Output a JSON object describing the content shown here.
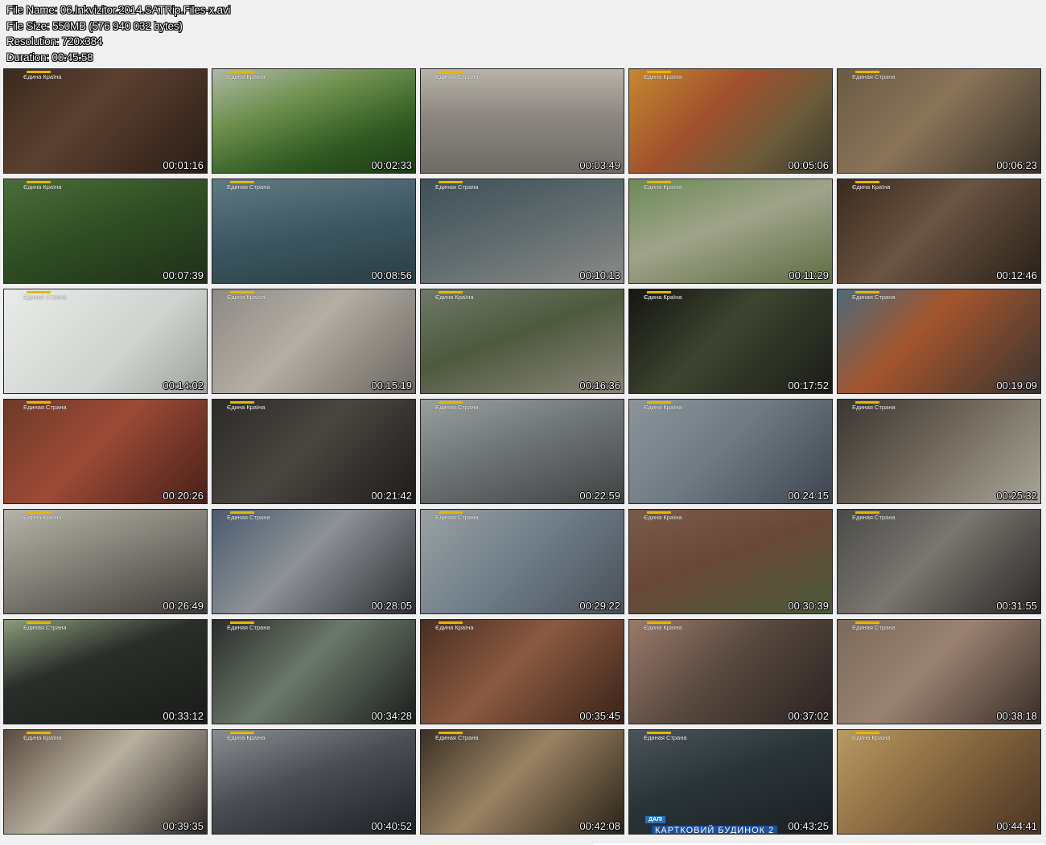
{
  "info": {
    "file_name": "File Name: 06.Inkvizitor.2014.SATRip.Files-x.avi",
    "file_size": "File Size: 550MB (576 940 032 bytes)",
    "resolution": "Resolution: 720x384",
    "duration": "Duration: 00:45:58"
  },
  "thumbnails": [
    {
      "time": "00:01:16",
      "logo": "Єдина Країна",
      "bg": "linear-gradient(135deg,#3a2a1e 0%,#5c4030 40%,#2a1d16 100%)"
    },
    {
      "time": "00:02:33",
      "logo": "Єдина Країна",
      "bg": "linear-gradient(160deg,#aeb9a8 0%,#6d8f4c 35%,#2f5a22 70%,#1d3b14 100%)"
    },
    {
      "time": "00:03:49",
      "logo": "Единая Страна",
      "bg": "linear-gradient(180deg,#b8b4ab 0%,#8c8880 45%,#6e6b65 100%)"
    },
    {
      "time": "00:05:06",
      "logo": "Єдина Країна",
      "bg": "linear-gradient(135deg,#c4892f 0%,#a1502d 40%,#6d5b3a 70%,#3c3a2c 100%)"
    },
    {
      "time": "00:06:23",
      "logo": "Единая Страна",
      "bg": "linear-gradient(135deg,#6b5a44 0%,#8a7458 45%,#3a3128 100%)"
    },
    {
      "time": "00:07:39",
      "logo": "Єдина Країна",
      "bg": "linear-gradient(160deg,#4a6d3a 0%,#2e4d22 50%,#1f2f1a 100%)"
    },
    {
      "time": "00:08:56",
      "logo": "Единая Страна",
      "bg": "linear-gradient(170deg,#5e7a82 0%,#3c5762 50%,#2a3e44 100%)"
    },
    {
      "time": "00:10:13",
      "logo": "Единая Страна",
      "bg": "linear-gradient(160deg,#3e5059 0%,#5f6b6e 50%,#8a8a86 100%)"
    },
    {
      "time": "00:11:29",
      "logo": "Єдина Країна",
      "bg": "linear-gradient(160deg,#6b8a55 0%,#a0a48a 45%,#5e6d43 100%)"
    },
    {
      "time": "00:12:46",
      "logo": "Єдина Країна",
      "bg": "linear-gradient(135deg,#3b2a1d 0%,#6a5442 45%,#2a2018 100%)"
    },
    {
      "time": "00:14:02",
      "logo": "Единая Страна",
      "bg": "linear-gradient(135deg,#e9ece8 0%,#cfd3cf 60%,#9ea39d 100%)"
    },
    {
      "time": "00:15:19",
      "logo": "Єдина Країна",
      "bg": "linear-gradient(135deg,#8d8a84 0%,#b4aea4 45%,#6a665f 100%)"
    },
    {
      "time": "00:16:36",
      "logo": "Єдина Країна",
      "bg": "linear-gradient(160deg,#6d7a68 0%,#4d5a3e 45%,#8a8478 100%)"
    },
    {
      "time": "00:17:52",
      "logo": "Єдина Країна",
      "bg": "linear-gradient(135deg,#151612 0%,#3d4530 45%,#1a1c16 100%)"
    },
    {
      "time": "00:19:09",
      "logo": "Единая Страна",
      "bg": "linear-gradient(135deg,#4d6a7a 0%,#a4552d 40%,#3a3430 100%)"
    },
    {
      "time": "00:20:26",
      "logo": "Единая Страна",
      "bg": "linear-gradient(135deg,#6d3a28 0%,#9c4a36 45%,#4a2018 100%)"
    },
    {
      "time": "00:21:42",
      "logo": "Єдина Країна",
      "bg": "linear-gradient(135deg,#2b2b28 0%,#4a4540 45%,#1e1c1a 100%)"
    },
    {
      "time": "00:22:59",
      "logo": "Единая Страна",
      "bg": "linear-gradient(160deg,#9aa0a0 0%,#6e7474 45%,#3f4242 100%)"
    },
    {
      "time": "00:24:15",
      "logo": "Єдина Країна",
      "bg": "linear-gradient(135deg,#8c949a 0%,#6f7b84 45%,#3e4650 100%)"
    },
    {
      "time": "00:25:32",
      "logo": "Единая Страна",
      "bg": "linear-gradient(135deg,#3b3632 0%,#6e6558 45%,#a8a498 100%)"
    },
    {
      "time": "00:26:49",
      "logo": "Єдина Країна",
      "bg": "linear-gradient(160deg,#b6b3a8 0%,#7d7a72 50%,#3e3c38 100%)"
    },
    {
      "time": "00:28:05",
      "logo": "Единая Страна",
      "bg": "linear-gradient(135deg,#4a5a6e 0%,#8d9296 45%,#2e3034 100%)"
    },
    {
      "time": "00:29:22",
      "logo": "Единая Страна",
      "bg": "linear-gradient(135deg,#9aa2a2 0%,#6d7c88 50%,#4a5058 100%)"
    },
    {
      "time": "00:30:39",
      "logo": "Єдина Країна",
      "bg": "linear-gradient(160deg,#7a5a48 0%,#6a4838 45%,#4a5a38 100%)"
    },
    {
      "time": "00:31:55",
      "logo": "Единая Страна",
      "bg": "linear-gradient(135deg,#4a4a48 0%,#7a7670 45%,#2a2826 100%)"
    },
    {
      "time": "00:33:12",
      "logo": "Единая Страна",
      "bg": "linear-gradient(160deg,#8a9c7a 0%,#2a2e2a 40%,#1a1c1a 100%)"
    },
    {
      "time": "00:34:28",
      "logo": "Единая Страна",
      "bg": "linear-gradient(135deg,#2a2c2a 0%,#6a786a 45%,#1c1e1c 100%)"
    },
    {
      "time": "00:35:45",
      "logo": "Єдина Країна",
      "bg": "linear-gradient(135deg,#4a2e22 0%,#8a5a40 45%,#3a2218 100%)"
    },
    {
      "time": "00:37:02",
      "logo": "Єдина Країна",
      "bg": "linear-gradient(135deg,#9a7a6a 0%,#5a4a40 45%,#2a2220 100%)"
    },
    {
      "time": "00:38:18",
      "logo": "Единая Страна",
      "bg": "linear-gradient(135deg,#7a6a5a 0%,#9a8272 45%,#3a2e28 100%)"
    },
    {
      "time": "00:39:35",
      "logo": "Єдина Країна",
      "bg": "linear-gradient(135deg,#5a4a3e 0%,#b8b0a0 45%,#2e2824 100%)"
    },
    {
      "time": "00:40:52",
      "logo": "Єдина Країна",
      "bg": "linear-gradient(160deg,#8a8e92 0%,#4a4e52 45%,#1e2226 100%)"
    },
    {
      "time": "00:42:08",
      "logo": "Единая Страна",
      "bg": "linear-gradient(135deg,#3a3026 0%,#9a8262 45%,#2a2218 100%)"
    },
    {
      "time": "00:43:25",
      "logo": "Единая Страна",
      "bg": "linear-gradient(160deg,#4a545a 0%,#2a3438 45%,#1a2024 100%)",
      "lower_tag": "ДАЛІ",
      "lower_text": "КАРТКОВИЙ БУДИНОК 2"
    },
    {
      "time": "00:44:41",
      "logo": "Єдина Країна",
      "bg": "linear-gradient(135deg,#b89a62 0%,#8a6a40 45%,#4a3422 100%)"
    }
  ]
}
